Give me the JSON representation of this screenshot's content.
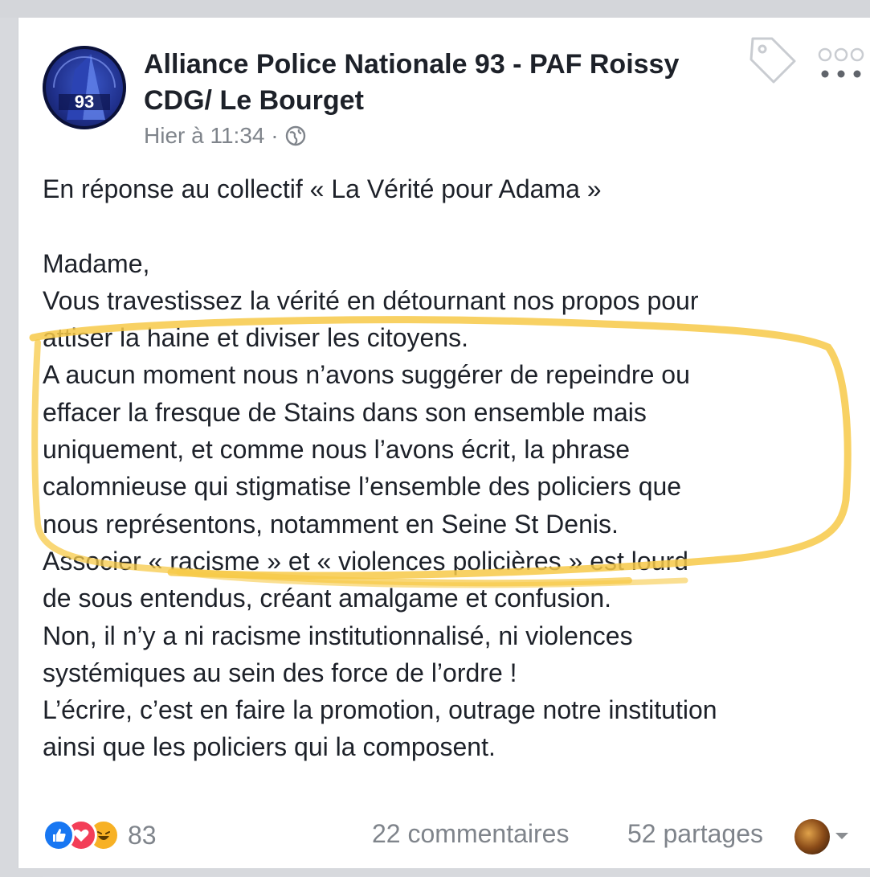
{
  "post": {
    "page_name": "Alliance Police Nationale 93 -  PAF Roissy CDG/ Le Bourget",
    "timestamp": "Hier à 11:34 ·",
    "avatar_text": "93",
    "lines": [
      "En réponse au collectif « La Vérité pour Adama »",
      "",
      "Madame,",
      "Vous travestissez la vérité en détournant nos propos pour",
      "attiser la haine et diviser les citoyens.",
      "A aucun moment nous n’avons suggérer de repeindre ou",
      "effacer la fresque de Stains dans son ensemble mais",
      "uniquement, et comme nous l’avons écrit, la phrase",
      "calomnieuse qui stigmatise l’ensemble des policiers que",
      "nous représentons, notamment en Seine St Denis.",
      "Associer « racisme » et « violences policières » est lourd",
      "de sous entendus, créant amalgame et confusion.",
      "Non, il n’y a ni racisme institutionnalisé, ni violences",
      "systémiques au sein des force de l’ordre !",
      "L’écrire, c’est en faire la promotion, outrage notre institution",
      "ainsi que les policiers qui la composent."
    ]
  },
  "footer": {
    "reaction_count": "83",
    "comments": "22 commentaires",
    "shares": "52 partages"
  },
  "icons": [
    "globe-icon",
    "tag-icon",
    "more-icon",
    "like-reaction-icon",
    "love-reaction-icon",
    "haha-reaction-icon",
    "caret-down-icon"
  ],
  "colors": {
    "text": "#1d2129",
    "secondary_text": "#7f848b",
    "highlight": "#f7c948",
    "like": "#1877f2",
    "love": "#f33e58",
    "haha": "#f7b125"
  }
}
